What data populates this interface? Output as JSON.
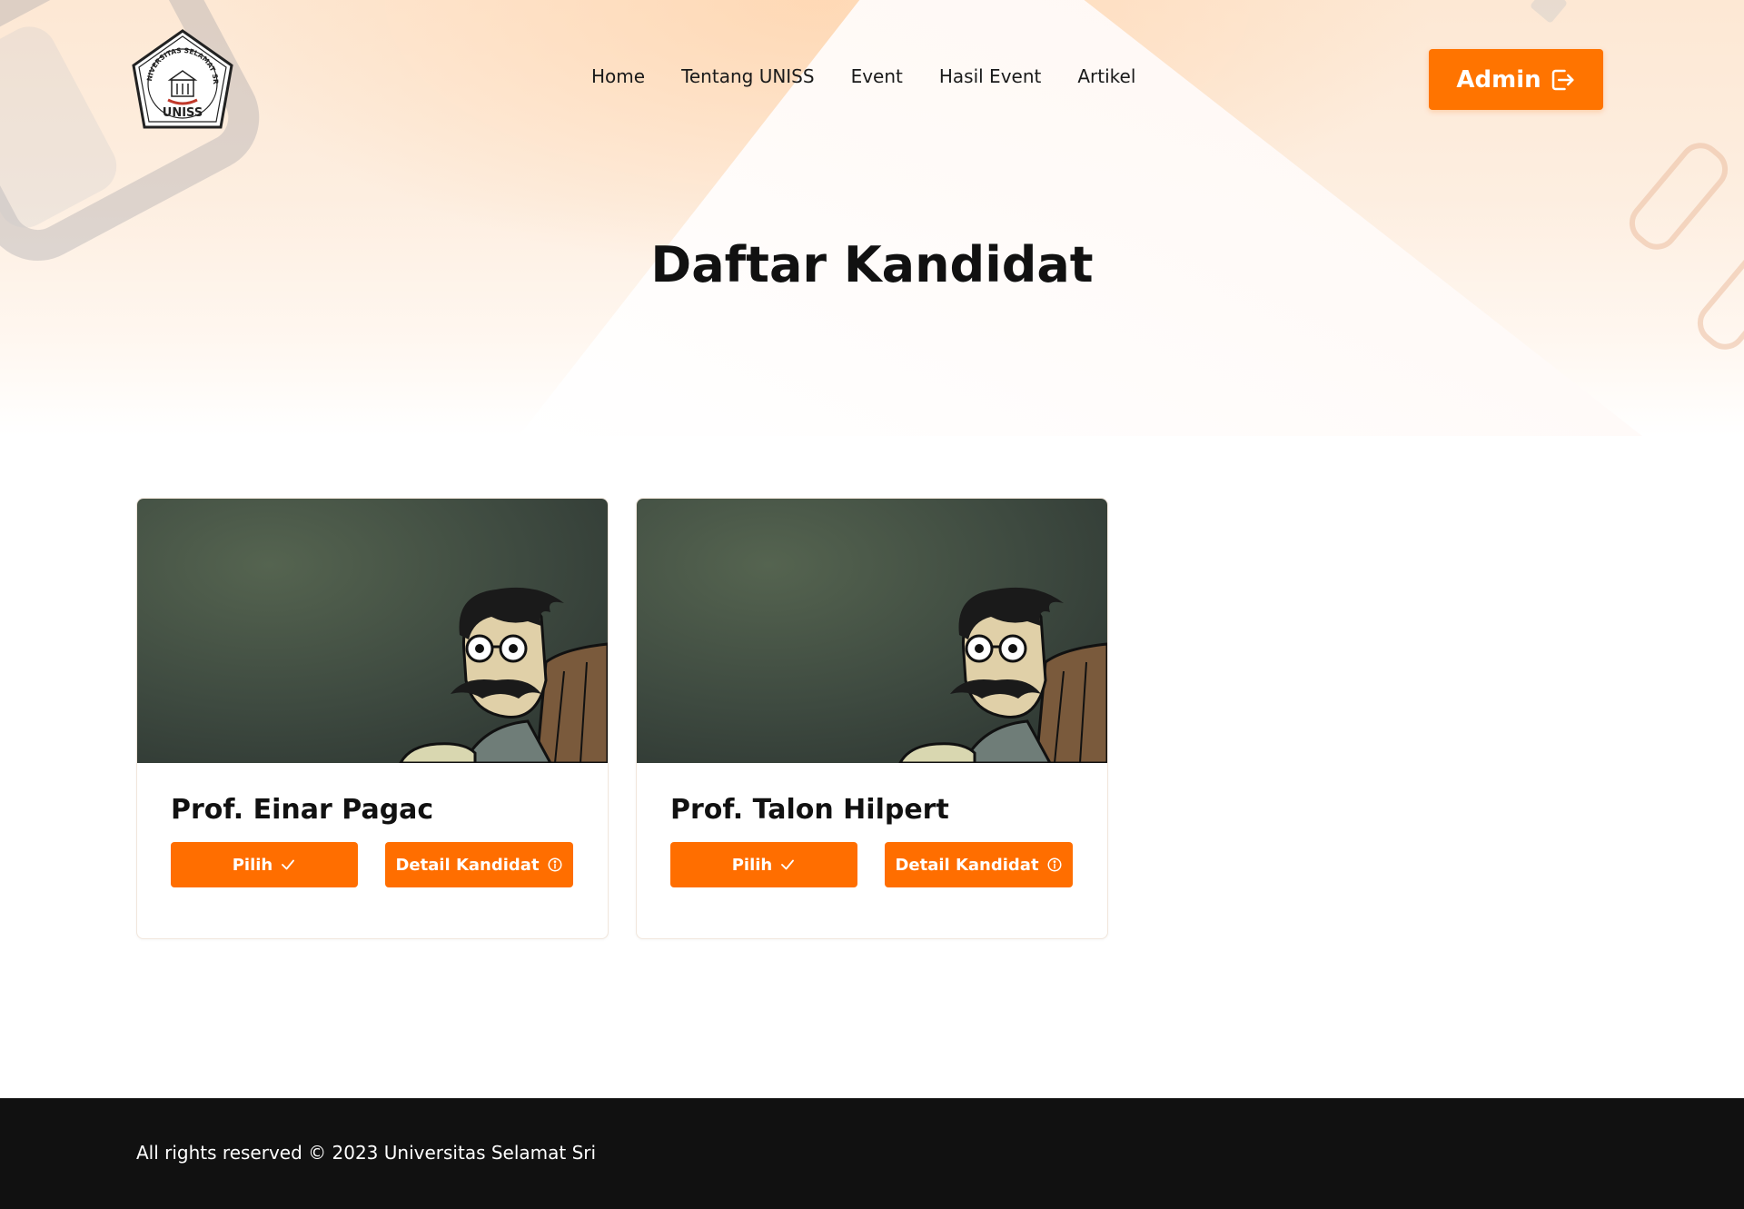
{
  "colors": {
    "accent": "#ff7400",
    "button": "#ff6e00",
    "footer_bg": "#111111"
  },
  "header": {
    "logo": {
      "top_text": "YAYASAN WAKAF SELAMAT SRI",
      "ring_text": "UNIVERSITAS SELAMAT SRI",
      "name": "UNISS"
    },
    "nav": [
      {
        "label": "Home"
      },
      {
        "label": "Tentang UNISS"
      },
      {
        "label": "Event"
      },
      {
        "label": "Hasil Event"
      },
      {
        "label": "Artikel"
      }
    ],
    "admin_label": "Admin",
    "admin_icon": "logout-icon"
  },
  "main": {
    "title": "Daftar Kandidat",
    "candidates": [
      {
        "name": "Prof. Einar Pagac",
        "image": "cartoon-professor-reading",
        "pilih_label": "Pilih",
        "pilih_icon": "check-icon",
        "detail_label": "Detail Kandidat",
        "detail_icon": "info-circle-icon"
      },
      {
        "name": "Prof. Talon Hilpert",
        "image": "cartoon-professor-reading",
        "pilih_label": "Pilih",
        "pilih_icon": "check-icon",
        "detail_label": "Detail Kandidat",
        "detail_icon": "info-circle-icon"
      }
    ]
  },
  "footer": {
    "text": "All rights reserved © 2023 Universitas Selamat Sri"
  }
}
